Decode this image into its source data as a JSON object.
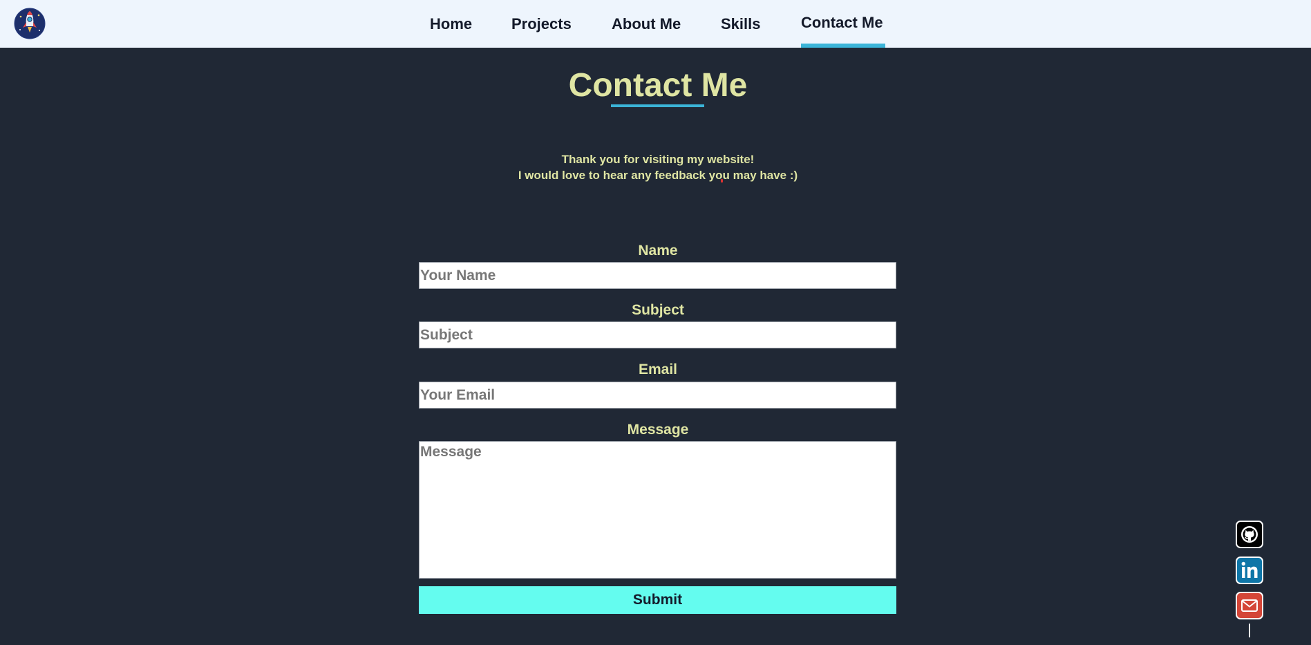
{
  "nav": {
    "logo_icon": "rocket-icon",
    "links": [
      {
        "label": "Home"
      },
      {
        "label": "Projects"
      },
      {
        "label": "About Me"
      },
      {
        "label": "Skills"
      },
      {
        "label": "Contact Me",
        "active": true
      }
    ]
  },
  "page": {
    "title": "Contact Me",
    "intro_line1": "Thank you for visiting my website!",
    "intro_line2": "I would love to hear any feedback you may have :)"
  },
  "form": {
    "name_label": "Name",
    "name_placeholder": "Your Name",
    "subject_label": "Subject",
    "subject_placeholder": "Subject",
    "email_label": "Email",
    "email_placeholder": "Your Email",
    "message_label": "Message",
    "message_placeholder": "Message",
    "submit_label": "Submit"
  },
  "social": [
    {
      "icon": "github-icon",
      "color": "#000000"
    },
    {
      "icon": "linkedin-icon",
      "color": "#0e76a8"
    },
    {
      "icon": "mail-icon",
      "color": "#d44638"
    }
  ],
  "colors": {
    "background": "#202835",
    "navbar": "#eef5fd",
    "accent": "#3bb4d8",
    "text_yellow": "#dfe5a3",
    "submit": "#64fcef"
  }
}
